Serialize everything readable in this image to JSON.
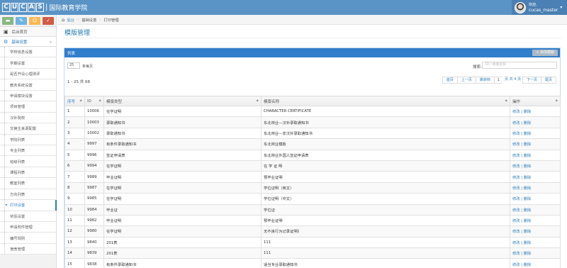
{
  "topbar": {
    "logo_letters": [
      "C",
      "U",
      "C",
      "A",
      "S"
    ],
    "logo_sep": "|",
    "logo_text": "国际教育学院",
    "user_welcome": "欢迎,",
    "user_name": "cucas_master",
    "caret": "▾"
  },
  "sidebar": {
    "shortcut_icons": [
      "signal-icon",
      "pencil-icon",
      "users-icon",
      "cogs-icon"
    ],
    "home_label": "后台首页",
    "section_label": "基础设置",
    "items": [
      "学校信息设置",
      "学期设置",
      "是否开设心理测评",
      "教务系统设置",
      "申请模块设置",
      "项目管理",
      "汉补院校",
      "交换生来源配置",
      "学院列表",
      "专业列表",
      "班级列表",
      "课程列表",
      "教室列表",
      "方向列表",
      "打印设置",
      "奖惩设置",
      "申请附件管理",
      "编号规则",
      "宿舍管理"
    ],
    "active_index": 14
  },
  "breadcrumb": {
    "home": "后台",
    "level1": "基础设置",
    "level2": "打印管理"
  },
  "page": {
    "title": "模版管理"
  },
  "panel": {
    "head": "列表",
    "add_button": "+ 添加模版",
    "length_value": "25",
    "length_label": "条每页",
    "search_label": "搜索:",
    "search_placeholder": "ID / 模版名称",
    "info": "1 - 25 共 68",
    "pager": {
      "first": "首页",
      "prev": "上一页",
      "jump": "跳转到",
      "page_value": "1",
      "page_of": "页 共 4 页",
      "next": "下一页",
      "last": "尾页"
    }
  },
  "table": {
    "headers": {
      "seq": "序号",
      "id": "ID",
      "type": "模版类型",
      "name": "模版名称",
      "ops": "操作"
    },
    "ops_label": "修改 | 删除",
    "rows": [
      {
        "seq": "1",
        "id": "10006",
        "type": "在学证明",
        "name": "CHARACTER CERTIFICATE"
      },
      {
        "seq": "2",
        "id": "10003",
        "type": "录取通知书",
        "name": "东北林业—汉补录取通知书"
      },
      {
        "seq": "3",
        "id": "10002",
        "type": "录取通知书",
        "name": "东北林业—非汉补录取通知书"
      },
      {
        "seq": "4",
        "id": "9997",
        "type": "有条件录取通知书",
        "name": "东北林业模板"
      },
      {
        "seq": "5",
        "id": "9996",
        "type": "签证申请表",
        "name": "东北林业外国人签证申请表"
      },
      {
        "seq": "6",
        "id": "9994",
        "type": "在学证明",
        "name": "在 学 证 明"
      },
      {
        "seq": "7",
        "id": "9989",
        "type": "毕业证明",
        "name": "预毕业证明"
      },
      {
        "seq": "8",
        "id": "9987",
        "type": "在学证明",
        "name": "学位证明（英文）"
      },
      {
        "seq": "9",
        "id": "9985",
        "type": "在学证明",
        "name": "学位证明（中文）"
      },
      {
        "seq": "10",
        "id": "9984",
        "type": "毕业证",
        "name": "学位证"
      },
      {
        "seq": "11",
        "id": "9982",
        "type": "毕业证明",
        "name": "预毕业证明"
      },
      {
        "seq": "12",
        "id": "9980",
        "type": "在学证明",
        "name": "无不良行为记录证明》"
      },
      {
        "seq": "13",
        "id": "9840",
        "type": "201表",
        "name": "111"
      },
      {
        "seq": "14",
        "id": "9839",
        "type": "201表",
        "name": "111"
      },
      {
        "seq": "15",
        "id": "9838",
        "type": "有条件录取通知书",
        "name": "适当专业录取通知书"
      }
    ]
  },
  "colors": {
    "topbar": "#5a93c6",
    "panel_head": "#307ecc",
    "link": "#2b7dbc"
  }
}
